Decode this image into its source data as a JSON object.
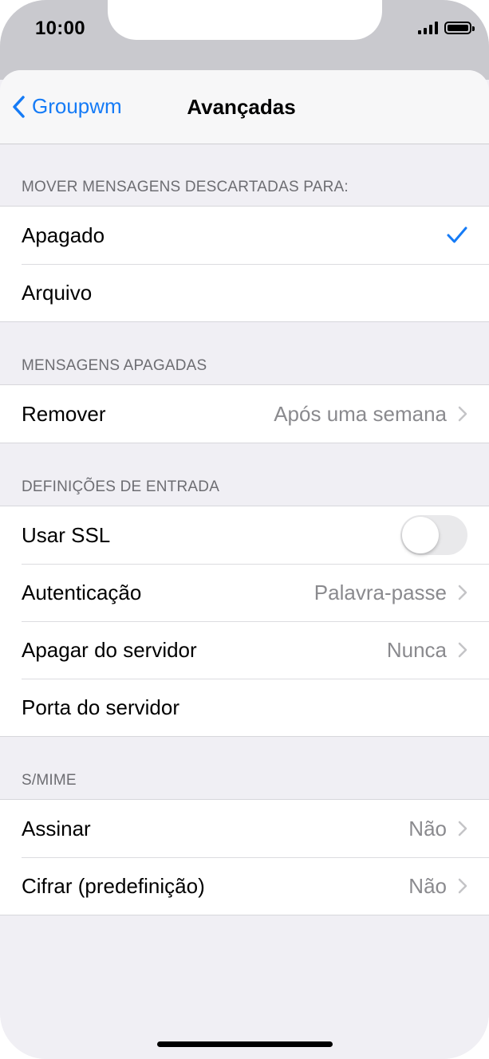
{
  "status_bar": {
    "time": "10:00"
  },
  "nav": {
    "back_label": "Groupwm",
    "title": "Avançadas"
  },
  "sections": {
    "move_discarded": {
      "header": "MOVER MENSAGENS DESCARTADAS PARA:",
      "rows": [
        {
          "label": "Apagado",
          "selected": true
        },
        {
          "label": "Arquivo",
          "selected": false
        }
      ]
    },
    "deleted_messages": {
      "header": "MENSAGENS APAGADAS",
      "rows": [
        {
          "label": "Remover",
          "value": "Após uma semana"
        }
      ]
    },
    "incoming_settings": {
      "header": "DEFINIÇÕES DE ENTRADA",
      "rows": [
        {
          "label": "Usar SSL",
          "toggle_on": false
        },
        {
          "label": "Autenticação",
          "value": "Palavra-passe"
        },
        {
          "label": "Apagar do servidor",
          "value": "Nunca"
        },
        {
          "label": "Porta do servidor"
        }
      ]
    },
    "smime": {
      "header": "S/MIME",
      "rows": [
        {
          "label": "Assinar",
          "value": "Não"
        },
        {
          "label": "Cifrar (predefinição)",
          "value": "Não"
        }
      ]
    }
  },
  "colors": {
    "accent": "#157bf6",
    "background": "#f0eff4",
    "secondary_text": "#8a8a8e",
    "header_text": "#6d6d72"
  }
}
